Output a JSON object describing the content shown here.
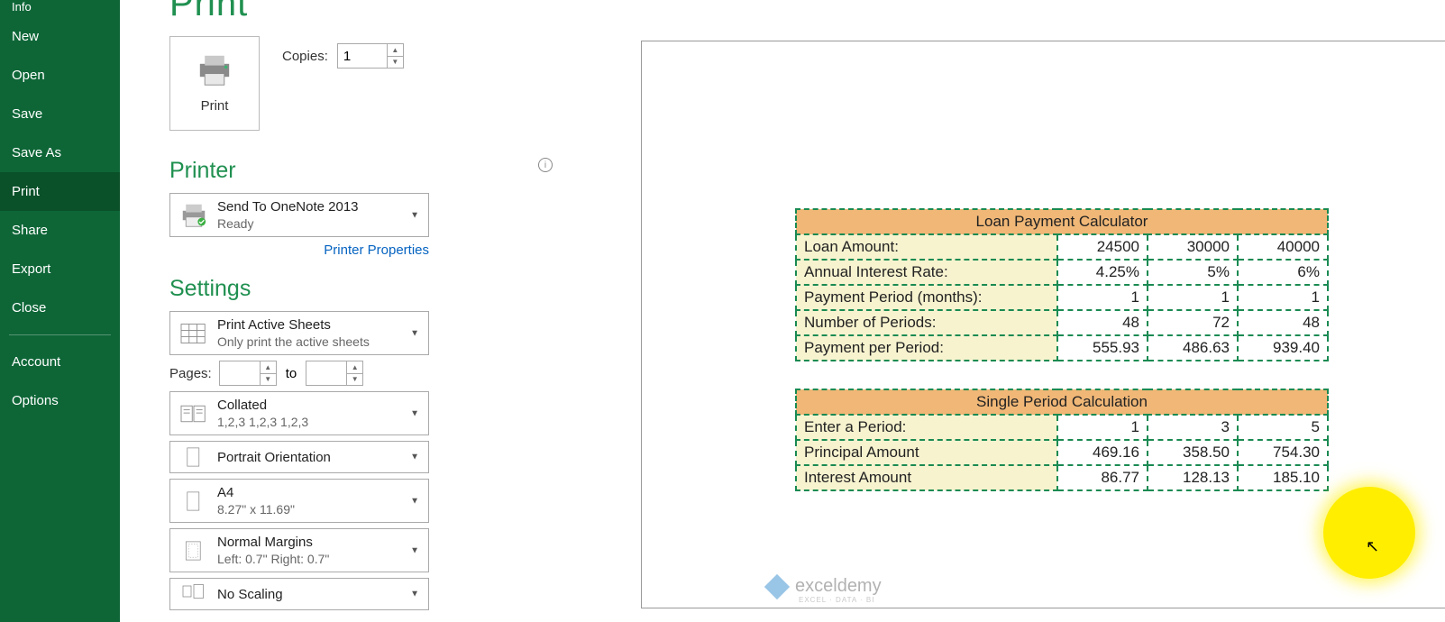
{
  "page": {
    "title": "Print"
  },
  "sidebar": {
    "items": [
      "Info",
      "New",
      "Open",
      "Save",
      "Save As",
      "Print",
      "Share",
      "Export",
      "Close",
      "Account",
      "Options"
    ],
    "active": "Print"
  },
  "printButton": {
    "label": "Print"
  },
  "copies": {
    "label": "Copies:",
    "value": "1"
  },
  "printer": {
    "heading": "Printer",
    "selected": {
      "name": "Send To OneNote 2013",
      "status": "Ready"
    },
    "propertiesLink": "Printer Properties"
  },
  "settings": {
    "heading": "Settings",
    "sheets": {
      "line1": "Print Active Sheets",
      "line2": "Only print the active sheets"
    },
    "pages": {
      "label": "Pages:",
      "from": "",
      "to": "",
      "toLabel": "to"
    },
    "collate": {
      "line1": "Collated",
      "line2": "1,2,3   1,2,3   1,2,3"
    },
    "orient": {
      "line1": "Portrait Orientation"
    },
    "paper": {
      "line1": "A4",
      "line2": "8.27\" x 11.69\""
    },
    "margins": {
      "line1": "Normal Margins",
      "line2": "Left:  0.7\"    Right:  0.7\""
    },
    "scaling": {
      "line1": "No Scaling"
    }
  },
  "preview": {
    "table1": {
      "title": "Loan Payment Calculator",
      "rows": [
        {
          "label": "Loan Amount:",
          "v": [
            "24500",
            "30000",
            "40000"
          ]
        },
        {
          "label": "Annual Interest Rate:",
          "v": [
            "4.25%",
            "5%",
            "6%"
          ]
        },
        {
          "label": "Payment Period (months):",
          "v": [
            "1",
            "1",
            "1"
          ]
        },
        {
          "label": "Number of Periods:",
          "v": [
            "48",
            "72",
            "48"
          ]
        },
        {
          "label": "Payment per Period:",
          "v": [
            "555.93",
            "486.63",
            "939.40"
          ]
        }
      ]
    },
    "table2": {
      "title": "Single Period Calculation",
      "rows": [
        {
          "label": "Enter a Period:",
          "v": [
            "1",
            "3",
            "5"
          ]
        },
        {
          "label": "Principal Amount",
          "v": [
            "469.16",
            "358.50",
            "754.30"
          ]
        },
        {
          "label": "Interest Amount",
          "v": [
            "86.77",
            "128.13",
            "185.10"
          ]
        }
      ]
    },
    "watermark": {
      "brand": "exceldemy",
      "tagline": "EXCEL · DATA · BI"
    }
  }
}
